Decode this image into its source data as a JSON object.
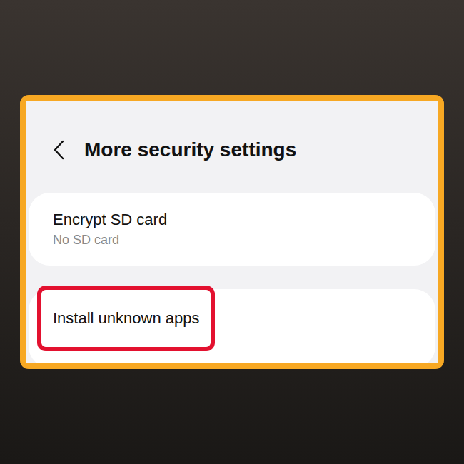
{
  "header": {
    "title": "More security settings"
  },
  "rows": [
    {
      "title": "Encrypt SD card",
      "subtitle": "No SD card",
      "highlighted": false
    },
    {
      "title": "Install unknown apps",
      "subtitle": "",
      "highlighted": true
    }
  ]
}
